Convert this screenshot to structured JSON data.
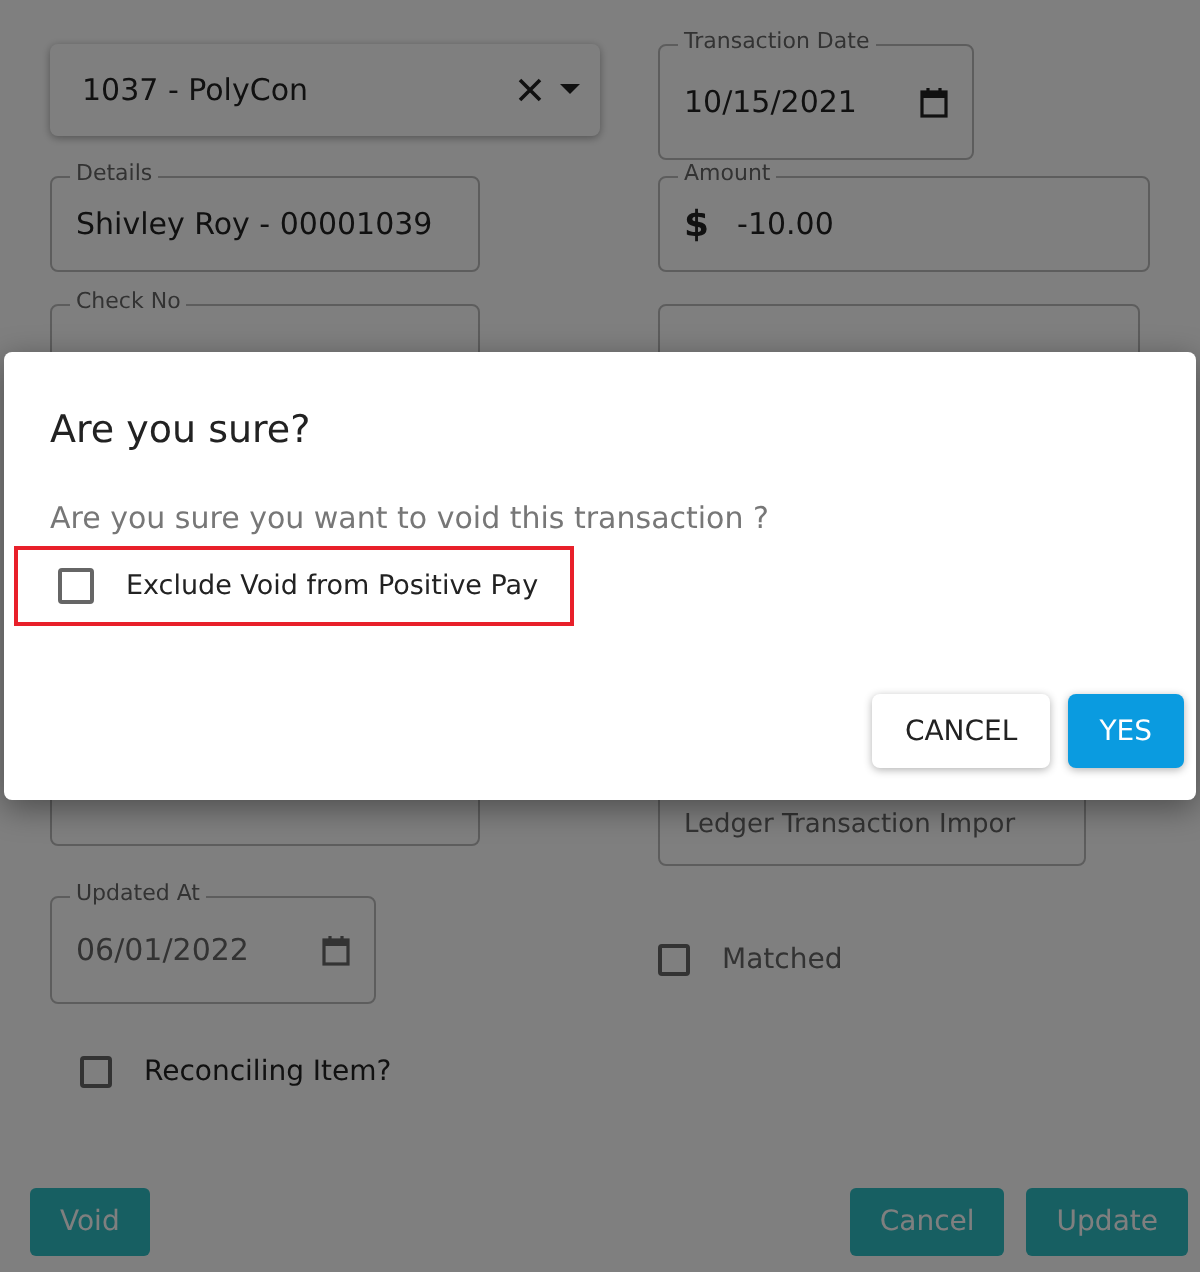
{
  "form": {
    "account": {
      "value": "1037 - PolyCon"
    },
    "transaction_date": {
      "label": "Transaction Date",
      "value": "10/15/2021"
    },
    "details": {
      "label": "Details",
      "value": "Shivley Roy - 00001039"
    },
    "amount": {
      "label": "Amount",
      "currency": "$",
      "value": "-10.00"
    },
    "check_no": {
      "label": "Check No"
    },
    "source": {
      "value": "Ledger Transaction Impor"
    },
    "updated_at": {
      "label": "Updated At",
      "value": "06/01/2022"
    },
    "matched": {
      "label": "Matched",
      "checked": false
    },
    "reconciling_item": {
      "label": "Reconciling Item?",
      "checked": false
    },
    "buttons": [
      {
        "label": "Void",
        "kind": "left"
      },
      {
        "label": "Cancel",
        "kind": "right"
      },
      {
        "label": "Update",
        "kind": "right"
      }
    ]
  },
  "dialog": {
    "title": "Are you sure?",
    "message": "Are you sure you want to void this transaction ?",
    "option": {
      "label": "Exclude Void from Positive Pay",
      "checked": false,
      "highlighted": true
    },
    "buttons": [
      {
        "label": "CANCEL",
        "kind": "secondary"
      },
      {
        "label": "YES",
        "kind": "primary"
      }
    ]
  }
}
